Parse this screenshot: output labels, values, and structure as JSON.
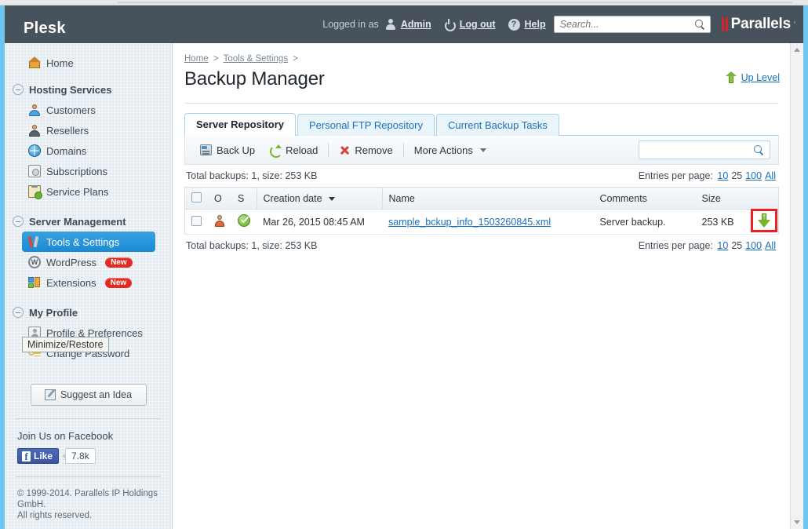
{
  "header": {
    "brand": "Plesk",
    "logged_in_as_label": "Logged in as",
    "user_icon": "user-icon",
    "user_name": "Admin",
    "power_icon": "power-icon",
    "logout_label": "Log out",
    "help_icon": "help-icon",
    "help_label": "Help",
    "search_placeholder": "Search...",
    "search_value": "",
    "search_icon": "search-icon",
    "vendor_logo_text": "Parallels",
    "vendor_logo_tm": "’",
    "bar_color": "#47525d",
    "vendor_accent": "#d8232a"
  },
  "sidebar": {
    "home": {
      "label": "Home",
      "icon": "home-icon"
    },
    "groups": [
      {
        "label": "Hosting Services",
        "collapse_icon": "collapse-minus-icon",
        "items": [
          {
            "label": "Customers",
            "icon": "user-blue-icon",
            "badge": ""
          },
          {
            "label": "Resellers",
            "icon": "user-dark-icon",
            "badge": ""
          },
          {
            "label": "Domains",
            "icon": "globe-icon",
            "badge": ""
          },
          {
            "label": "Subscriptions",
            "icon": "subscriptions-icon",
            "badge": ""
          },
          {
            "label": "Service Plans",
            "icon": "service-plan-icon",
            "badge": ""
          }
        ]
      },
      {
        "label": "Server Management",
        "collapse_icon": "collapse-minus-icon",
        "items": [
          {
            "label": "Tools & Settings",
            "icon": "tools-icon",
            "badge": "",
            "selected": true
          },
          {
            "label": "WordPress",
            "icon": "wordpress-icon",
            "badge": "New"
          },
          {
            "label": "Extensions",
            "icon": "extensions-icon",
            "badge": "New"
          }
        ]
      },
      {
        "label": "My Profile",
        "collapse_icon": "collapse-minus-icon",
        "items": [
          {
            "label": "Profile & Preferences",
            "icon": "profile-icon",
            "badge": ""
          },
          {
            "label": "Change Password",
            "icon": "key-icon",
            "badge": ""
          }
        ]
      }
    ],
    "tooltip": "Minimize/Restore",
    "suggest_button": {
      "label": "Suggest an Idea",
      "icon": "suggest-icon"
    },
    "facebook": {
      "title": "Join Us on Facebook",
      "like_label": "Like",
      "like_glyph": "f",
      "count": "7.8k"
    },
    "copyright_line1": "© 1999-2014. Parallels IP Holdings GmbH.",
    "copyright_line2": "All rights reserved.",
    "badge_color": "#e12b23",
    "selected_color": "#1b8ad4"
  },
  "breadcrumb": {
    "items": [
      "Home",
      "Tools & Settings"
    ],
    "separator": ">"
  },
  "page": {
    "title": "Backup Manager",
    "up_level_label": "Up Level",
    "up_level_icon": "up-arrow-icon"
  },
  "tabs": [
    {
      "label": "Server Repository",
      "active": true
    },
    {
      "label": "Personal FTP Repository",
      "active": false
    },
    {
      "label": "Current Backup Tasks",
      "active": false
    }
  ],
  "toolbar": {
    "buttons": [
      {
        "label": "Back Up",
        "icon": "backup-icon"
      },
      {
        "label": "Reload",
        "icon": "reload-icon"
      },
      {
        "label": "Remove",
        "icon": "remove-icon"
      },
      {
        "label": "More Actions",
        "icon": "chevron-down-icon"
      }
    ],
    "search_value": "",
    "search_icon": "search-icon"
  },
  "summary": {
    "total_text": "Total backups: 1, size: 253 KB",
    "entries_label": "Entries per page:",
    "entries_options": [
      "10",
      "25",
      "100",
      "All"
    ],
    "entries_selected": "25"
  },
  "table": {
    "columns": [
      {
        "key": "check",
        "label": ""
      },
      {
        "key": "o",
        "label": "O"
      },
      {
        "key": "s",
        "label": "S"
      },
      {
        "key": "date",
        "label": "Creation date",
        "sorted": "desc",
        "sort_icon": "caret-down-icon"
      },
      {
        "key": "name",
        "label": "Name"
      },
      {
        "key": "comments",
        "label": "Comments"
      },
      {
        "key": "size",
        "label": "Size"
      },
      {
        "key": "dl",
        "label": ""
      }
    ],
    "rows": [
      {
        "checked": false,
        "owner_icon": "owner-person-icon",
        "status_icon": "status-ok-icon",
        "date": "Mar 26, 2015 08:45 AM",
        "name": "sample_bckup_info_1503260845.xml",
        "comments": "Server backup.",
        "size": "253 KB",
        "download_icon": "download-arrow-icon"
      }
    ]
  },
  "annotation": {
    "highlight_color": "#ec2024",
    "target": "download-arrow-icon"
  },
  "scrollbar": {
    "up_icon": "scroll-up-icon",
    "down_icon": "scroll-down-icon"
  }
}
